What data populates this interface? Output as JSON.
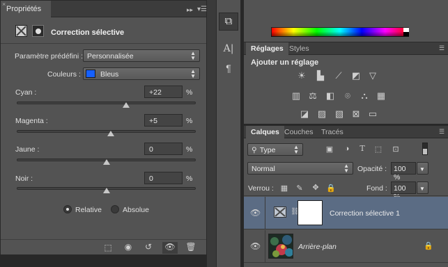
{
  "properties_panel": {
    "tab_label": "Propriétés",
    "adjustment_title": "Correction sélective",
    "preset_label": "Paramètre prédéfini :",
    "preset_value": "Personnalisée",
    "colors_label": "Couleurs :",
    "colors_value": "Bleus",
    "colors_swatch": "#1560ff",
    "sliders": [
      {
        "label": "Cyan :",
        "value": "+22",
        "unit": "%",
        "fraction": 0.61
      },
      {
        "label": "Magenta :",
        "value": "+5",
        "unit": "%",
        "fraction": 0.525
      },
      {
        "label": "Jaune :",
        "value": "0",
        "unit": "%",
        "fraction": 0.5
      },
      {
        "label": "Noir :",
        "value": "0",
        "unit": "%",
        "fraction": 0.5
      }
    ],
    "mode_relative": "Relative",
    "mode_absolute": "Absolue",
    "selected_mode": "Relative"
  },
  "adjustments_panel": {
    "tabs": [
      "Réglages",
      "Styles"
    ],
    "heading": "Ajouter un réglage"
  },
  "layers_panel": {
    "tabs": [
      "Calques",
      "Couches",
      "Tracés"
    ],
    "filter_value": "Type",
    "blend_mode": "Normal",
    "opacity_label": "Opacité :",
    "opacity_value": "100 %",
    "lock_label": "Verrou :",
    "fill_label": "Fond :",
    "fill_value": "100 %",
    "layers": [
      {
        "name": "Correction sélective 1",
        "selected": true
      },
      {
        "name": "Arrière-plan",
        "selected": false,
        "locked": true
      }
    ]
  },
  "colors": {
    "panel_bg": "#535353",
    "selected_layer_bg": "#5b6c84"
  }
}
